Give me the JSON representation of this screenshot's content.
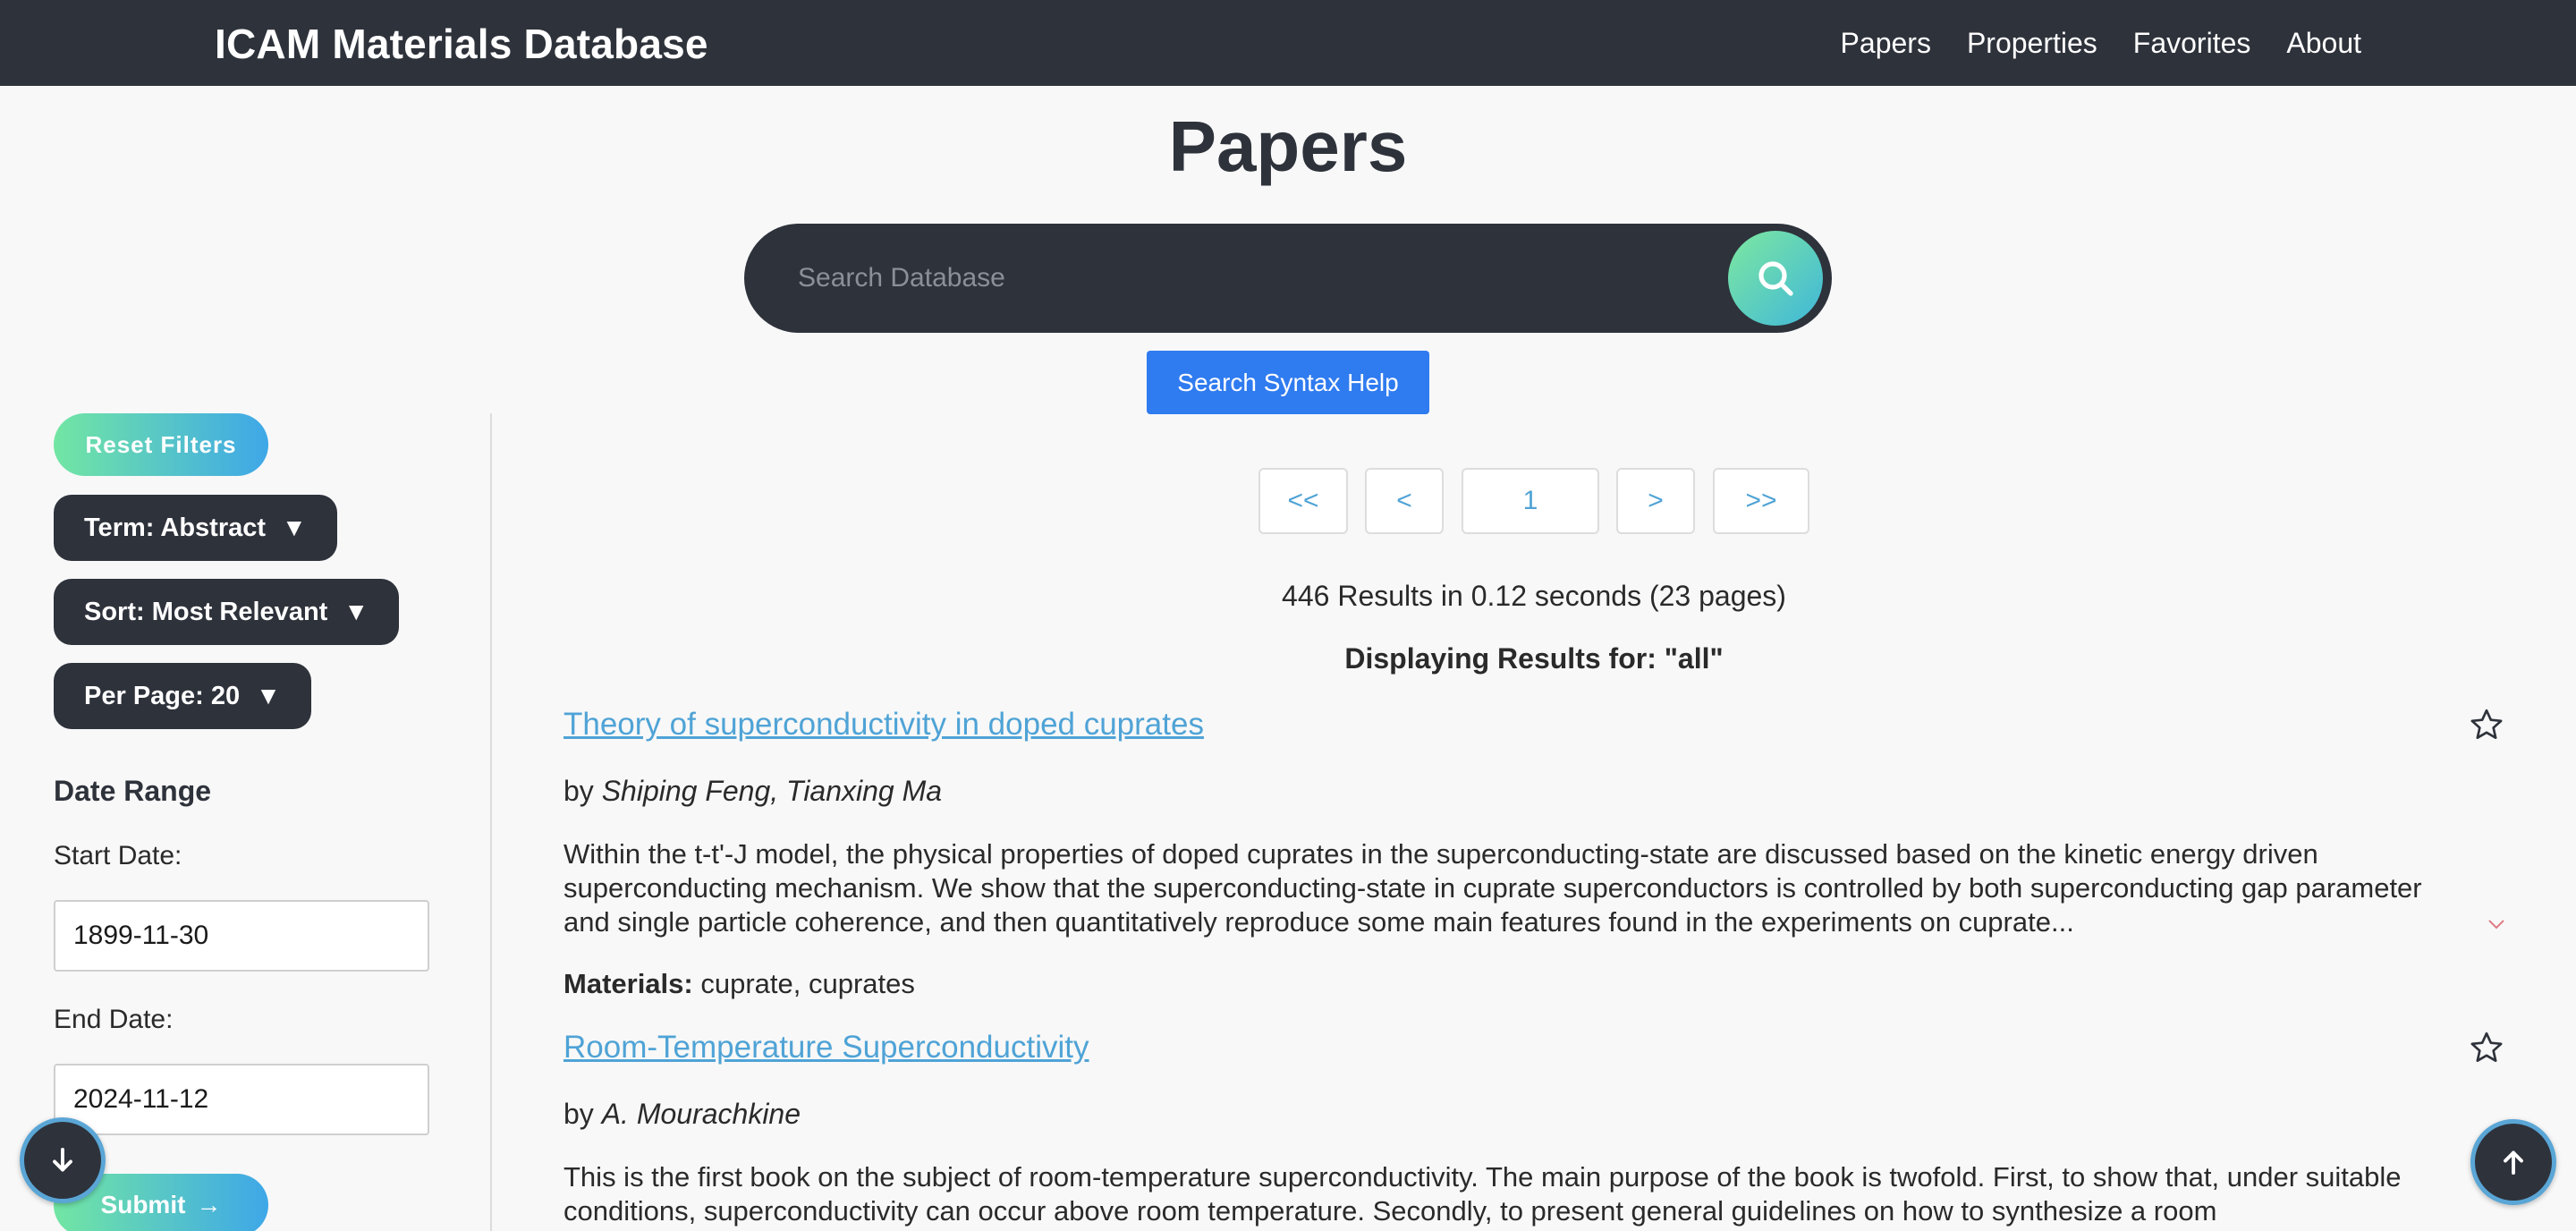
{
  "navbar": {
    "brand": "ICAM Materials Database",
    "links": [
      "Papers",
      "Properties",
      "Favorites",
      "About"
    ]
  },
  "page": {
    "title": "Papers"
  },
  "search": {
    "placeholder": "Search Database",
    "value": "",
    "help_label": "Search Syntax Help"
  },
  "sidebar": {
    "reset_label": "Reset Filters",
    "term_label": "Term: Abstract",
    "sort_label": "Sort: Most Relevant",
    "per_page_label": "Per Page: 20",
    "caret": "▼",
    "date_range_heading": "Date Range",
    "start_label": "Start Date:",
    "start_value": "1899-11-30",
    "end_label": "End Date:",
    "end_value": "2024-11-12",
    "submit_label": "Submit",
    "submit_arrow": "→"
  },
  "pagination": {
    "first": "<<",
    "prev": "<",
    "current": "1",
    "next": ">",
    "last": ">>"
  },
  "results": {
    "summary": "446 Results in 0.12 seconds (23 pages)",
    "displaying_for": "Displaying Results for: \"all\""
  },
  "papers": [
    {
      "title": "Theory of superconductivity in doped cuprates",
      "by": "by",
      "authors": "Shiping Feng, Tianxing Ma",
      "abstract": "Within the t-t'-J model, the physical properties of doped cuprates in the superconducting-state are discussed based on the kinetic energy driven superconducting mechanism. We show that the superconducting-state in cuprate superconductors is controlled by both superconducting gap parameter and single particle coherence, and then quantitatively reproduce some main features found in the experiments on cuprate...",
      "materials_label": "Materials:",
      "materials": "cuprate, cuprates"
    },
    {
      "title": "Room-Temperature Superconductivity",
      "by": "by",
      "authors": "A. Mourachkine",
      "abstract": "This is the first book on the subject of room-temperature superconductivity. The main purpose of the book is twofold. First, to show that, under suitable conditions, superconductivity can occur above room temperature. Secondly, to present general guidelines on how to synthesize a room"
    }
  ],
  "colors": {
    "navbar": "#2e323b",
    "accent_blue": "#2f7bf0",
    "link": "#4fa3d6",
    "gradient_start": "#72e6a3",
    "gradient_end": "#3ea7e8"
  },
  "icons": {
    "search": "search-icon",
    "star": "star-outline-icon",
    "expand": "chevron-down-icon",
    "scroll_down": "arrow-down-icon",
    "scroll_up": "arrow-up-icon"
  }
}
